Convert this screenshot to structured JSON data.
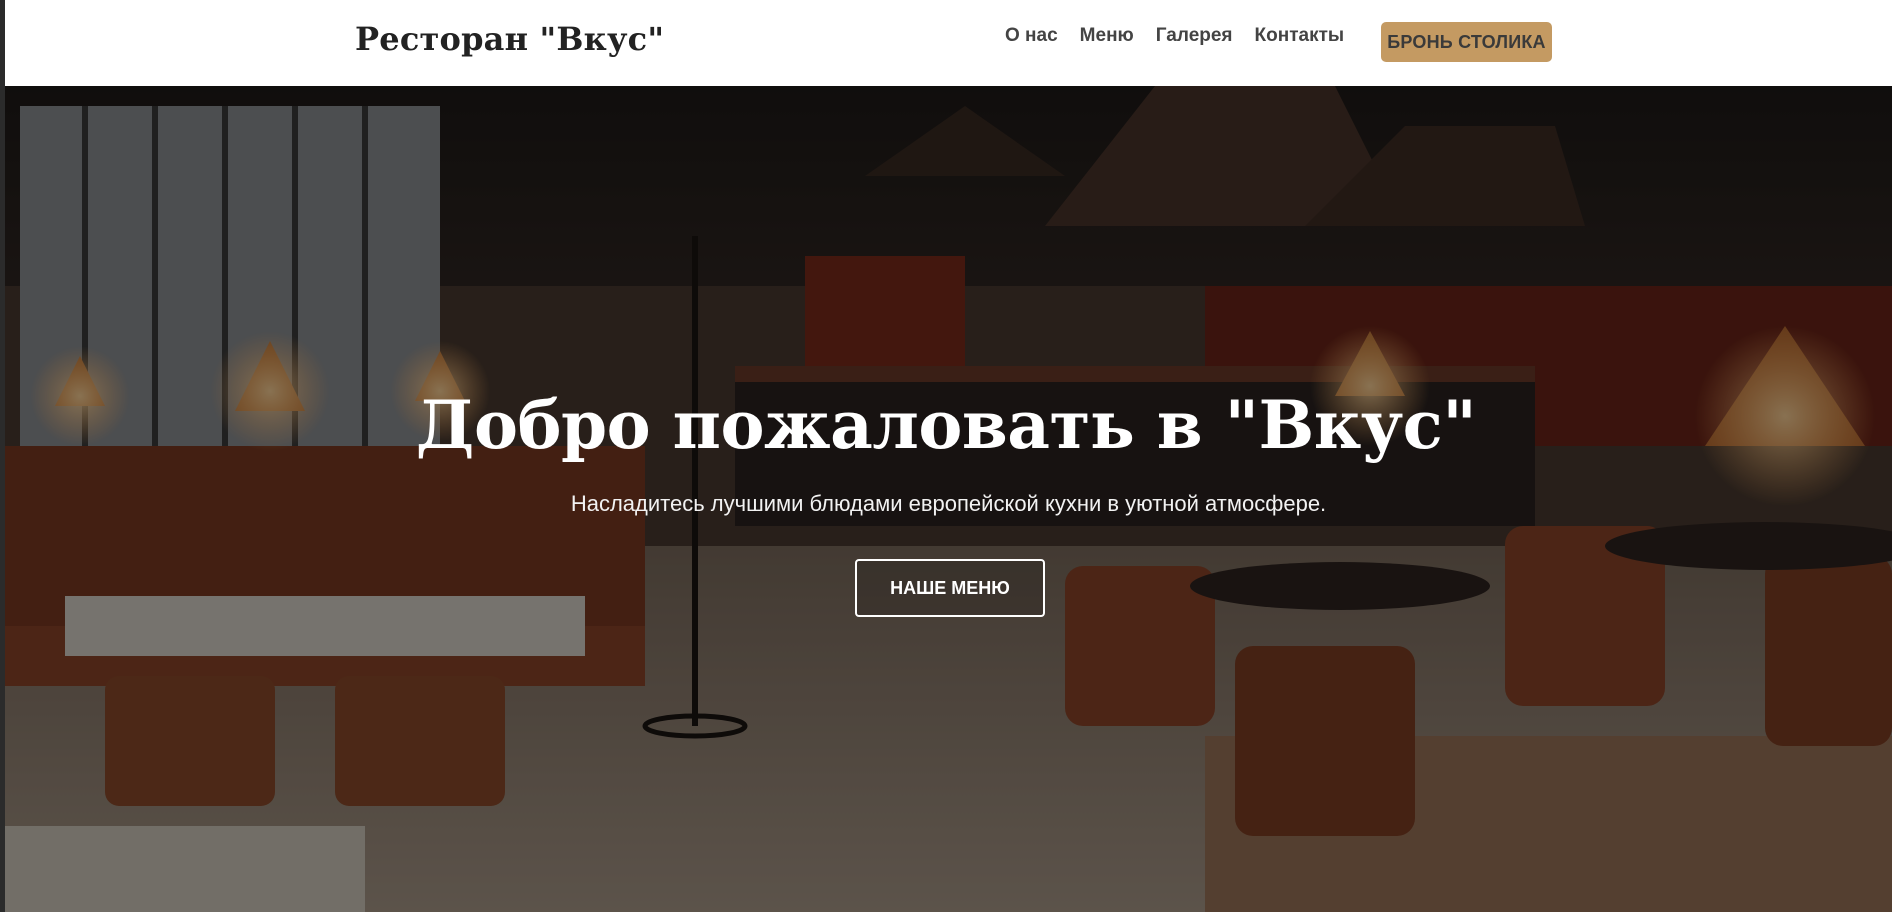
{
  "header": {
    "brand": "Ресторан \"Вкус\"",
    "nav": [
      "О нас",
      "Меню",
      "Галерея",
      "Контакты"
    ],
    "cta": "БРОНЬ СТОЛИКА"
  },
  "hero": {
    "title": "Добро пожаловать в \"Вкус\"",
    "subtitle": "Насладитесь лучшими блюдами европейской кухни в уютной атмосфере.",
    "button": "НАШЕ МЕНЮ"
  },
  "colors": {
    "accent": "#c49a62",
    "nav_text": "#444444",
    "brand_text": "#222222",
    "hero_text": "#ffffff"
  }
}
